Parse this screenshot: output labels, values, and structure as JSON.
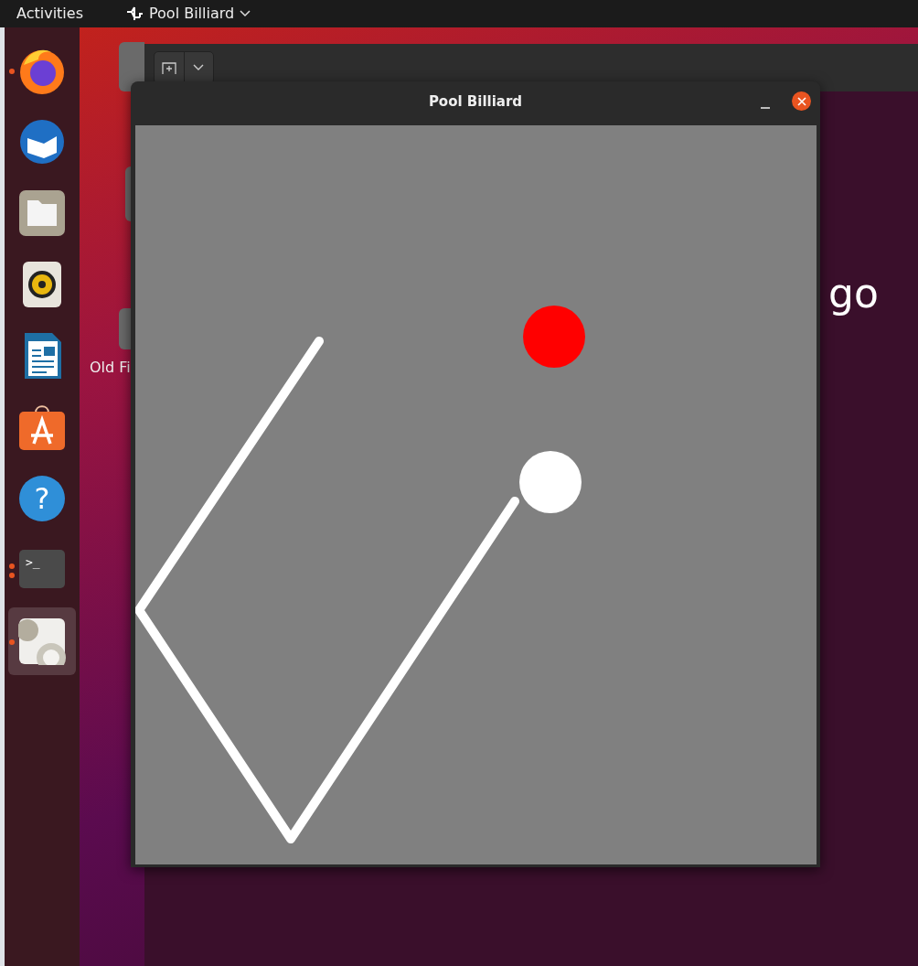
{
  "top_bar": {
    "activities": "Activities",
    "app_name": "Pool Billiard"
  },
  "dock": {
    "items": [
      {
        "kind": "browser",
        "running": true,
        "multiple_windows": false,
        "selected": false
      },
      {
        "kind": "mail",
        "running": false,
        "selected": false
      },
      {
        "kind": "files",
        "running": false,
        "selected": false
      },
      {
        "kind": "music",
        "running": false,
        "selected": false
      },
      {
        "kind": "writer",
        "running": false,
        "selected": false
      },
      {
        "kind": "store",
        "running": false,
        "selected": false
      },
      {
        "kind": "help",
        "glyph": "?",
        "running": false,
        "selected": false
      },
      {
        "kind": "terminal",
        "glyph": ">_",
        "running": true,
        "multiple_windows": true,
        "selected": false
      },
      {
        "kind": "gears",
        "running": true,
        "multiple_windows": false,
        "selected": true
      }
    ]
  },
  "desktop_icons": [
    {
      "label": "Old Fi"
    }
  ],
  "back_window": {
    "text": "go"
  },
  "window": {
    "title": "Pool Billiard"
  }
}
